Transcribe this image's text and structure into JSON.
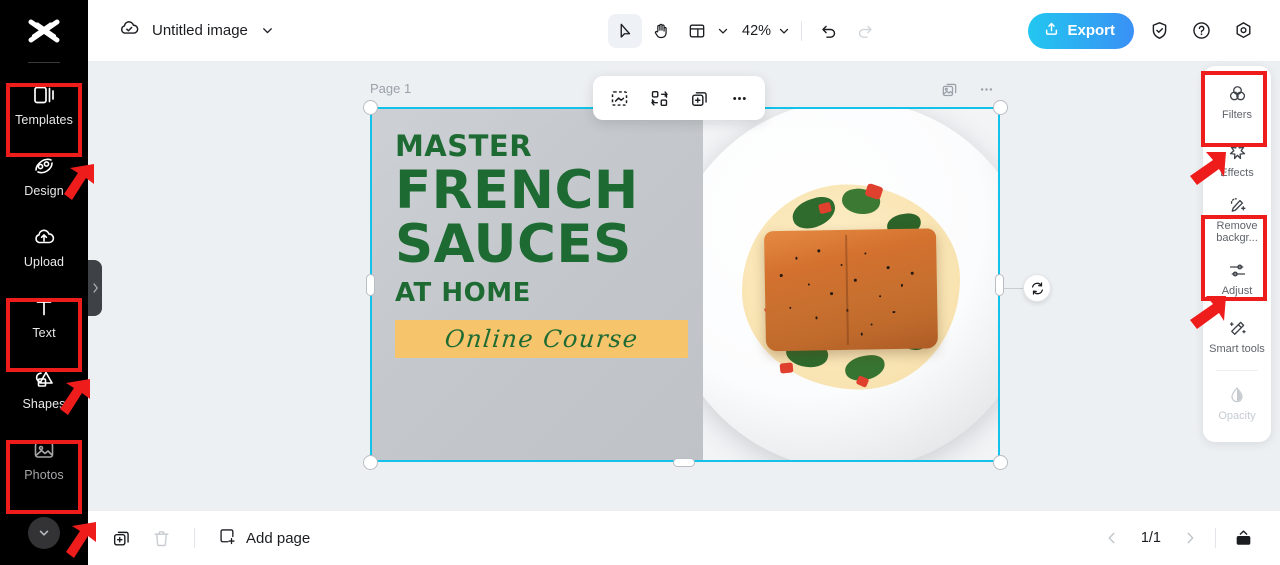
{
  "app": {
    "logo": "capcut-logo"
  },
  "sidebar": {
    "items": [
      {
        "label": "Templates",
        "icon": "templates-icon",
        "dim": false,
        "highlighted": true
      },
      {
        "label": "Design",
        "icon": "design-icon",
        "dim": false,
        "highlighted": false
      },
      {
        "label": "Upload",
        "icon": "upload-cloud-icon",
        "dim": false,
        "highlighted": false
      },
      {
        "label": "Text",
        "icon": "text-icon",
        "dim": false,
        "highlighted": true
      },
      {
        "label": "Shapes",
        "icon": "shapes-icon",
        "dim": false,
        "highlighted": false
      },
      {
        "label": "Photos",
        "icon": "photos-icon",
        "dim": true,
        "highlighted": true
      }
    ],
    "scroll_down": "chevron-down-icon"
  },
  "topbar": {
    "cloud_status_icon": "cloud-check-icon",
    "doc_title": "Untitled image",
    "title_chevron": "chevron-down-icon",
    "tools": [
      {
        "name": "select-tool",
        "icon": "cursor-arrow-icon",
        "active": true
      },
      {
        "name": "hand-tool",
        "icon": "hand-icon",
        "active": false
      },
      {
        "name": "layout-tool",
        "icon": "layout-grid-icon",
        "active": false
      }
    ],
    "layout_chevron": "chevron-down-icon",
    "zoom_level": "42%",
    "zoom_chevron": "chevron-down-icon",
    "undo": {
      "label": "undo-icon",
      "enabled": true
    },
    "redo": {
      "label": "redo-icon",
      "enabled": false
    },
    "export_label": "Export",
    "export_icon": "upload-box-icon",
    "export_color": "#22c7f0",
    "right_icons": [
      {
        "name": "shield-check-icon"
      },
      {
        "name": "help-question-icon"
      },
      {
        "name": "settings-hex-icon"
      }
    ]
  },
  "canvas": {
    "page_label": "Page 1",
    "collapse_tab_icon": "chevron-right-icon",
    "float_toolbar": [
      {
        "name": "crop-select-icon"
      },
      {
        "name": "replace-swap-icon"
      },
      {
        "name": "duplicate-plus-icon"
      },
      {
        "name": "more-ellipsis-icon"
      }
    ],
    "corner_tools": [
      {
        "name": "image-layers-icon"
      },
      {
        "name": "more-ellipsis-icon"
      }
    ],
    "selection": {
      "color": "#12c2e9",
      "rotate_icon": "rotate-icon"
    },
    "poster": {
      "line1": "MASTER",
      "line2": "FRENCH",
      "line3": "SAUCES",
      "line4": "AT HOME",
      "banner_text": "Online Course",
      "text_color": "#1d6b33",
      "banner_color": "#f6c46a",
      "photo_subject": "seared-salmon-on-plate"
    }
  },
  "right_panel": {
    "items": [
      {
        "label": "Filters",
        "icon": "filters-circles-icon",
        "disabled": false,
        "highlighted": true
      },
      {
        "label": "Effects",
        "icon": "effects-sparkle-icon",
        "disabled": false,
        "highlighted": false
      },
      {
        "label": "Remove backgr...",
        "icon": "remove-background-icon",
        "disabled": false,
        "highlighted": true
      },
      {
        "label": "Adjust",
        "icon": "adjust-sliders-icon",
        "disabled": false,
        "highlighted": false
      },
      {
        "label": "Smart tools",
        "icon": "smart-tools-wand-icon",
        "disabled": false,
        "highlighted": false
      },
      {
        "label": "Opacity",
        "icon": "opacity-droplet-icon",
        "disabled": true,
        "highlighted": false
      }
    ]
  },
  "bottombar": {
    "duplicate_icon": "duplicate-page-icon",
    "delete_icon": "trash-icon",
    "add_page_label": "Add page",
    "add_page_icon": "add-page-icon",
    "prev_icon": "chevron-left-icon",
    "page_indicator": "1/1",
    "next_icon": "chevron-right-icon",
    "expand_panel_icon": "expand-panel-icon"
  },
  "annotations": {
    "color": "#ef1c1c",
    "boxes": [
      "templates",
      "text",
      "photos",
      "filters",
      "remove-background"
    ],
    "arrows": 5
  }
}
